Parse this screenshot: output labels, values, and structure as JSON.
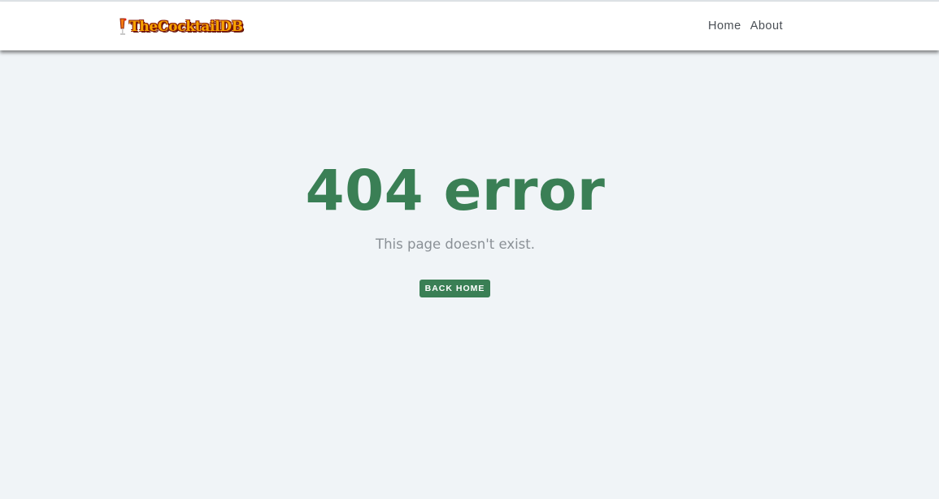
{
  "navbar": {
    "logo_text": "TheCocktailDB",
    "links": [
      {
        "label": "Home"
      },
      {
        "label": "About"
      }
    ]
  },
  "main": {
    "error_title": "404 error",
    "error_message": "This page doesn't exist.",
    "back_button_label": "BACK HOME"
  },
  "colors": {
    "accent": "#3a7f55",
    "page_background": "#f0f4f7",
    "navbar_background": "#ffffff",
    "nav_text": "#4a4f55",
    "subtitle_text": "#8a9096"
  }
}
